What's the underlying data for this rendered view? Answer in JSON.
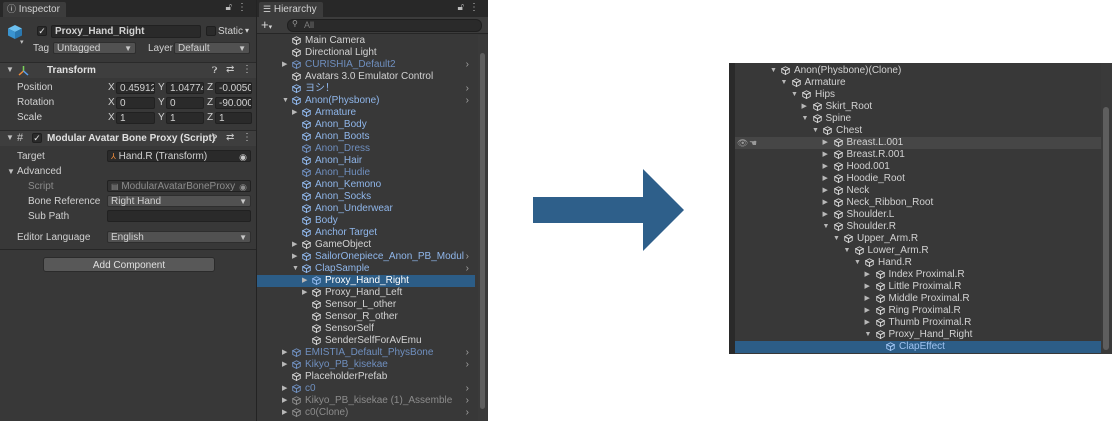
{
  "inspector": {
    "tab_label": "Inspector",
    "object_name": "Proxy_Hand_Right",
    "static_label": "Static",
    "tag_label": "Tag",
    "tag_value": "Untagged",
    "layer_label": "Layer",
    "layer_value": "Default",
    "transform": {
      "title": "Transform",
      "position_label": "Position",
      "rotation_label": "Rotation",
      "scale_label": "Scale",
      "position": {
        "x": "0.45912",
        "y": "1.04774",
        "z": "-0.0050"
      },
      "rotation": {
        "x": "0",
        "y": "0",
        "z": "-90.000"
      },
      "scale": {
        "x": "1",
        "y": "1",
        "z": "1"
      }
    },
    "axis_x": "X",
    "axis_y": "Y",
    "axis_z": "Z",
    "bone_proxy": {
      "title": "Modular Avatar Bone Proxy (Script)",
      "target_label": "Target",
      "target_value": "Hand.R (Transform)",
      "advanced_label": "Advanced",
      "script_label": "Script",
      "script_value": "ModularAvatarBoneProxy",
      "bone_ref_label": "Bone Reference",
      "bone_ref_value": "Right Hand",
      "subpath_label": "Sub Path",
      "subpath_value": "",
      "editor_lang_label": "Editor Language",
      "editor_lang_value": "English"
    },
    "add_component": "Add Component"
  },
  "hierarchy": {
    "tab_label": "Hierarchy",
    "add_label": "+",
    "search_placeholder": "All",
    "items": [
      {
        "label": "Main Camera",
        "depth": 0,
        "style": "normal",
        "arrow": "",
        "chevron": false
      },
      {
        "label": "Directional Light",
        "depth": 0,
        "style": "normal",
        "arrow": "",
        "chevron": false
      },
      {
        "label": "CURISHIA_Default2",
        "depth": 0,
        "style": "fadedblue",
        "arrow": "▶",
        "chevron": true
      },
      {
        "label": "Avatars 3.0 Emulator Control",
        "depth": 0,
        "style": "normal",
        "arrow": "",
        "chevron": false
      },
      {
        "label": "ヨシ！",
        "depth": 0,
        "style": "blue",
        "arrow": "",
        "chevron": true
      },
      {
        "label": "Anon(Physbone)",
        "depth": 0,
        "style": "blue",
        "arrow": "▼",
        "chevron": true
      },
      {
        "label": "Armature",
        "depth": 1,
        "style": "blue",
        "arrow": "▶",
        "chevron": false
      },
      {
        "label": "Anon_Body",
        "depth": 1,
        "style": "blue",
        "arrow": "",
        "chevron": false
      },
      {
        "label": "Anon_Boots",
        "depth": 1,
        "style": "blue",
        "arrow": "",
        "chevron": false
      },
      {
        "label": "Anon_Dress",
        "depth": 1,
        "style": "fadedblue",
        "arrow": "",
        "chevron": false
      },
      {
        "label": "Anon_Hair",
        "depth": 1,
        "style": "blue",
        "arrow": "",
        "chevron": false
      },
      {
        "label": "Anon_Hudie",
        "depth": 1,
        "style": "fadedblue",
        "arrow": "",
        "chevron": false
      },
      {
        "label": "Anon_Kemono",
        "depth": 1,
        "style": "blue",
        "arrow": "",
        "chevron": false
      },
      {
        "label": "Anon_Socks",
        "depth": 1,
        "style": "blue",
        "arrow": "",
        "chevron": false
      },
      {
        "label": "Anon_Underwear",
        "depth": 1,
        "style": "blue",
        "arrow": "",
        "chevron": false
      },
      {
        "label": "Body",
        "depth": 1,
        "style": "blue",
        "arrow": "",
        "chevron": false
      },
      {
        "label": "Anchor Target",
        "depth": 1,
        "style": "blue",
        "arrow": "",
        "chevron": false
      },
      {
        "label": "GameObject",
        "depth": 1,
        "style": "normal",
        "arrow": "▶",
        "chevron": false
      },
      {
        "label": "SailorOnepiece_Anon_PB_Modul",
        "depth": 1,
        "style": "blue",
        "arrow": "▶",
        "chevron": true
      },
      {
        "label": "ClapSample",
        "depth": 1,
        "style": "blue",
        "arrow": "▼",
        "chevron": true
      },
      {
        "label": "Proxy_Hand_Right",
        "depth": 2,
        "style": "selected",
        "arrow": "▶",
        "chevron": false
      },
      {
        "label": "Proxy_Hand_Left",
        "depth": 2,
        "style": "normal",
        "arrow": "▶",
        "chevron": false
      },
      {
        "label": "Sensor_L_other",
        "depth": 2,
        "style": "normal",
        "arrow": "",
        "chevron": false
      },
      {
        "label": "Sensor_R_other",
        "depth": 2,
        "style": "normal",
        "arrow": "",
        "chevron": false
      },
      {
        "label": "SensorSelf",
        "depth": 2,
        "style": "normal",
        "arrow": "",
        "chevron": false
      },
      {
        "label": "SenderSelfForAvEmu",
        "depth": 2,
        "style": "normal",
        "arrow": "",
        "chevron": false
      },
      {
        "label": "EMISTIA_Default_PhysBone",
        "depth": 0,
        "style": "fadedblue",
        "arrow": "▶",
        "chevron": true
      },
      {
        "label": "Kikyo_PB_kisekae",
        "depth": 0,
        "style": "fadedblue",
        "arrow": "▶",
        "chevron": true
      },
      {
        "label": "PlaceholderPrefab",
        "depth": 0,
        "style": "normal",
        "arrow": "",
        "chevron": false
      },
      {
        "label": "c0",
        "depth": 0,
        "style": "fadedblue",
        "arrow": "▶",
        "chevron": true
      },
      {
        "label": "Kikyo_PB_kisekae (1)_Assemble",
        "depth": 0,
        "style": "faded",
        "arrow": "▶",
        "chevron": true
      },
      {
        "label": "c0(Clone)",
        "depth": 0,
        "style": "faded",
        "arrow": "▶",
        "chevron": true
      }
    ]
  },
  "arrow_color": "#2e5f8a",
  "right_hierarchy": {
    "items": [
      {
        "label": "Anon(Physbone)(Clone)",
        "depth": 0,
        "arrow": "▼",
        "state": "normal"
      },
      {
        "label": "Armature",
        "depth": 1,
        "arrow": "▼",
        "state": "normal"
      },
      {
        "label": "Hips",
        "depth": 2,
        "arrow": "▼",
        "state": "normal"
      },
      {
        "label": "Skirt_Root",
        "depth": 3,
        "arrow": "▶",
        "state": "normal"
      },
      {
        "label": "Spine",
        "depth": 3,
        "arrow": "▼",
        "state": "normal"
      },
      {
        "label": "Chest",
        "depth": 4,
        "arrow": "▼",
        "state": "normal"
      },
      {
        "label": "Breast.L.001",
        "depth": 5,
        "arrow": "▶",
        "state": "hover"
      },
      {
        "label": "Breast.R.001",
        "depth": 5,
        "arrow": "▶",
        "state": "normal"
      },
      {
        "label": "Hood.001",
        "depth": 5,
        "arrow": "▶",
        "state": "normal"
      },
      {
        "label": "Hoodie_Root",
        "depth": 5,
        "arrow": "▶",
        "state": "normal"
      },
      {
        "label": "Neck",
        "depth": 5,
        "arrow": "▶",
        "state": "normal"
      },
      {
        "label": "Neck_Ribbon_Root",
        "depth": 5,
        "arrow": "▶",
        "state": "normal"
      },
      {
        "label": "Shoulder.L",
        "depth": 5,
        "arrow": "▶",
        "state": "normal"
      },
      {
        "label": "Shoulder.R",
        "depth": 5,
        "arrow": "▼",
        "state": "normal"
      },
      {
        "label": "Upper_Arm.R",
        "depth": 6,
        "arrow": "▼",
        "state": "normal"
      },
      {
        "label": "Lower_Arm.R",
        "depth": 7,
        "arrow": "▼",
        "state": "normal"
      },
      {
        "label": "Hand.R",
        "depth": 8,
        "arrow": "▼",
        "state": "normal"
      },
      {
        "label": "Index Proximal.R",
        "depth": 9,
        "arrow": "▶",
        "state": "normal"
      },
      {
        "label": "Little Proximal.R",
        "depth": 9,
        "arrow": "▶",
        "state": "normal"
      },
      {
        "label": "Middle Proximal.R",
        "depth": 9,
        "arrow": "▶",
        "state": "normal"
      },
      {
        "label": "Ring Proximal.R",
        "depth": 9,
        "arrow": "▶",
        "state": "normal"
      },
      {
        "label": "Thumb Proximal.R",
        "depth": 9,
        "arrow": "▶",
        "state": "normal"
      },
      {
        "label": "Proxy_Hand_Right",
        "depth": 9,
        "arrow": "▼",
        "state": "normal"
      },
      {
        "label": "ClapEffect",
        "depth": 10,
        "arrow": "",
        "state": "selected"
      }
    ]
  }
}
